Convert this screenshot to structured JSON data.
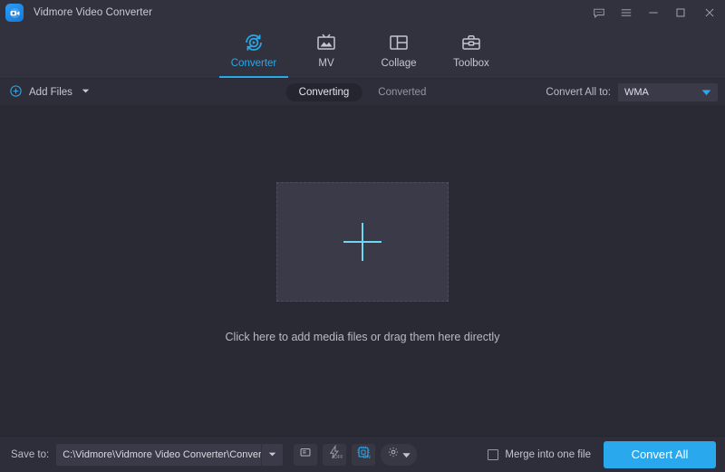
{
  "window": {
    "title": "Vidmore Video Converter",
    "logo_icon": "video-camera-icon",
    "controls": [
      {
        "name": "feedback-icon",
        "label": "Feedback"
      },
      {
        "name": "menu-icon",
        "label": "Menu"
      },
      {
        "name": "minimize-icon",
        "label": "Minimize"
      },
      {
        "name": "maximize-icon",
        "label": "Maximize"
      },
      {
        "name": "close-icon",
        "label": "Close"
      }
    ]
  },
  "nav": {
    "tabs": [
      {
        "label": "Converter",
        "icon": "converter-icon",
        "active": true
      },
      {
        "label": "MV",
        "icon": "mv-icon",
        "active": false
      },
      {
        "label": "Collage",
        "icon": "collage-icon",
        "active": false
      },
      {
        "label": "Toolbox",
        "icon": "toolbox-icon",
        "active": false
      }
    ]
  },
  "toolbar": {
    "add_files_label": "Add Files",
    "add_files_icon": "plus-circle-icon",
    "add_files_caret": "chevron-down-icon",
    "segments": [
      {
        "label": "Converting",
        "active": true
      },
      {
        "label": "Converted",
        "active": false
      }
    ],
    "convert_all_label": "Convert All to:",
    "format_value": "WMA",
    "format_caret": "triangle-down-icon"
  },
  "main": {
    "dropzone_icon": "plus-icon",
    "hint": "Click here to add media files or drag them here directly"
  },
  "bottom": {
    "save_to_label": "Save to:",
    "save_path": "C:\\Vidmore\\Vidmore Video Converter\\Converted",
    "path_caret": "chevron-down-icon",
    "open_folder_icon": "folder-open-icon",
    "hardware_accel": {
      "icon": "lightning-icon",
      "state": "OFF"
    },
    "gpu_accel": {
      "icon": "cpu-chip-icon",
      "state": "ON"
    },
    "settings_icon": "gear-icon",
    "settings_caret": "triangle-down-icon",
    "merge_label": "Merge into one file",
    "merge_checked": false,
    "convert_button": "Convert All"
  },
  "colors": {
    "accent": "#2aa8ee",
    "titlebar": "#32323f",
    "toolbar": "#2e2e3a",
    "canvas": "#2a2a35",
    "dropzone": "#3a3a49",
    "plus": "#6fd6f2"
  }
}
